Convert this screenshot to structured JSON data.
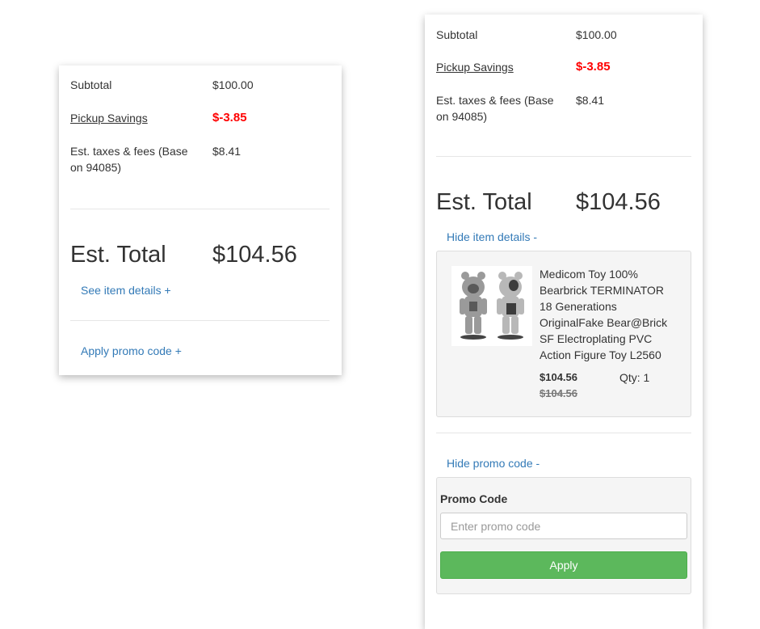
{
  "left_card": {
    "subtotal_label": "Subtotal",
    "subtotal_value": "$100.00",
    "pickup_label": "Pickup Savings",
    "pickup_value": "$-3.85",
    "taxes_label": "Est. taxes & fees (Base on 94085)",
    "taxes_value": "$8.41",
    "total_label": "Est. Total",
    "total_value": "$104.56",
    "item_details_link": "See item details +",
    "promo_link": "Apply promo code +"
  },
  "right_card": {
    "subtotal_label": "Subtotal",
    "subtotal_value": "$100.00",
    "pickup_label": "Pickup Savings",
    "pickup_value": "$-3.85",
    "taxes_label": "Est. taxes & fees (Base on 94085)",
    "taxes_value": "$8.41",
    "total_label": "Est. Total",
    "total_value": "$104.56",
    "item_details_link": "Hide item details -",
    "item": {
      "name": "Medicom Toy 100% Bearbrick TERMINATOR 18 Generations OriginalFake Bear@Brick SF Electroplating PVC Action Figure Toy L2560",
      "price": "$104.56",
      "original_price": "$104.56",
      "qty": "Qty: 1"
    },
    "promo_link": "Hide promo code -",
    "promo_label": "Promo Code",
    "promo_placeholder": "Enter promo code",
    "apply_label": "Apply"
  },
  "colors": {
    "savings_red": "#ff0000",
    "link_blue": "#337ab7",
    "apply_green": "#5cb85c"
  }
}
